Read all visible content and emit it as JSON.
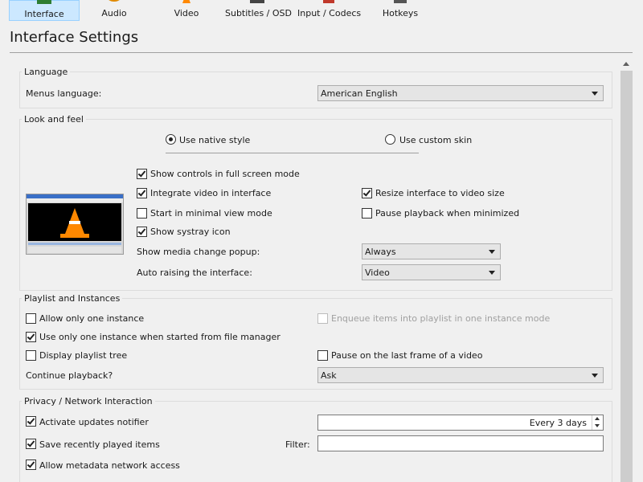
{
  "toolbar": {
    "items": [
      {
        "label": "Interface",
        "icon": "interface-icon",
        "active": true
      },
      {
        "label": "Audio",
        "icon": "audio-icon"
      },
      {
        "label": "Video",
        "icon": "video-icon"
      },
      {
        "label": "Subtitles / OSD",
        "icon": "subtitles-icon"
      },
      {
        "label": "Input / Codecs",
        "icon": "input-codecs-icon"
      },
      {
        "label": "Hotkeys",
        "icon": "hotkeys-icon"
      }
    ]
  },
  "page_title": "Interface Settings",
  "language": {
    "title": "Language",
    "menus_language_label": "Menus language:",
    "menus_language_value": "American English"
  },
  "look": {
    "title": "Look and feel",
    "native_style": {
      "label": "Use native style",
      "selected": true
    },
    "custom_skin": {
      "label": "Use custom skin",
      "selected": false
    },
    "show_controls_fullscreen": {
      "label": "Show controls in full screen mode",
      "checked": true
    },
    "integrate_video": {
      "label": "Integrate video in interface",
      "checked": true
    },
    "resize_interface": {
      "label": "Resize interface to video size",
      "checked": true
    },
    "minimal_view": {
      "label": "Start in minimal view mode",
      "checked": false
    },
    "pause_minimized": {
      "label": "Pause playback when minimized",
      "checked": false
    },
    "systray": {
      "label": "Show systray icon",
      "checked": true
    },
    "media_popup_label": "Show media change popup:",
    "media_popup_value": "Always",
    "auto_raise_label": "Auto raising the interface:",
    "auto_raise_value": "Video"
  },
  "playlist": {
    "title": "Playlist and Instances",
    "one_instance": {
      "label": "Allow only one instance",
      "checked": false
    },
    "enqueue": {
      "label": "Enqueue items into playlist in one instance mode",
      "checked": false,
      "disabled": true
    },
    "file_manager": {
      "label": "Use only one instance when started from file manager",
      "checked": true
    },
    "playlist_tree": {
      "label": "Display playlist tree",
      "checked": false
    },
    "pause_last_frame": {
      "label": "Pause on the last frame of a video",
      "checked": false
    },
    "continue_label": "Continue playback?",
    "continue_value": "Ask"
  },
  "privacy": {
    "title": "Privacy / Network Interaction",
    "updates": {
      "label": "Activate updates notifier",
      "checked": true
    },
    "updates_interval": "Every 3 days",
    "recent": {
      "label": "Save recently played items",
      "checked": true
    },
    "filter_label": "Filter:",
    "filter_value": "",
    "metadata": {
      "label": "Allow metadata network access",
      "checked": true
    }
  },
  "colors": {
    "active_tab_bg": "#cce8ff",
    "active_tab_border": "#99d1ff",
    "vlc_cone": "#ff8800"
  }
}
